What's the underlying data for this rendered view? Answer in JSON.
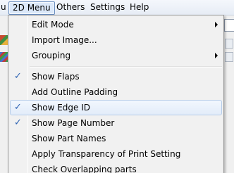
{
  "menubar": {
    "partial_left": "u",
    "items": [
      "2D Menu",
      "Others",
      "Settings",
      "Help"
    ],
    "active": "2D Menu"
  },
  "left_toolbar": {
    "icons": [
      "paint-tool-icon",
      "color-swatch-icon"
    ]
  },
  "dropdown": {
    "items": [
      {
        "label": "Edit Mode",
        "checked": false,
        "submenu": true
      },
      {
        "label": "Import Image...",
        "checked": false,
        "submenu": false
      },
      {
        "label": "Grouping",
        "checked": false,
        "submenu": true
      },
      {
        "separator": true
      },
      {
        "label": "Show Flaps",
        "checked": true,
        "submenu": false
      },
      {
        "label": "Add Outline Padding",
        "checked": false,
        "submenu": false
      },
      {
        "label": "Show Edge ID",
        "checked": true,
        "submenu": false,
        "highlighted": true
      },
      {
        "label": "Show Page Number",
        "checked": true,
        "submenu": false
      },
      {
        "label": "Show Part Names",
        "checked": false,
        "submenu": false
      },
      {
        "label": "Apply Transparency of Print Setting",
        "checked": false,
        "submenu": false
      },
      {
        "label": "Check Overlapping parts",
        "checked": false,
        "submenu": false
      }
    ],
    "check_glyph": "✓"
  },
  "colors": {
    "menu_bg": "#f1f1f1",
    "highlight_border": "#b6cce8",
    "check_color": "#2e63b3",
    "active_menu_border": "#6a8ebf"
  }
}
